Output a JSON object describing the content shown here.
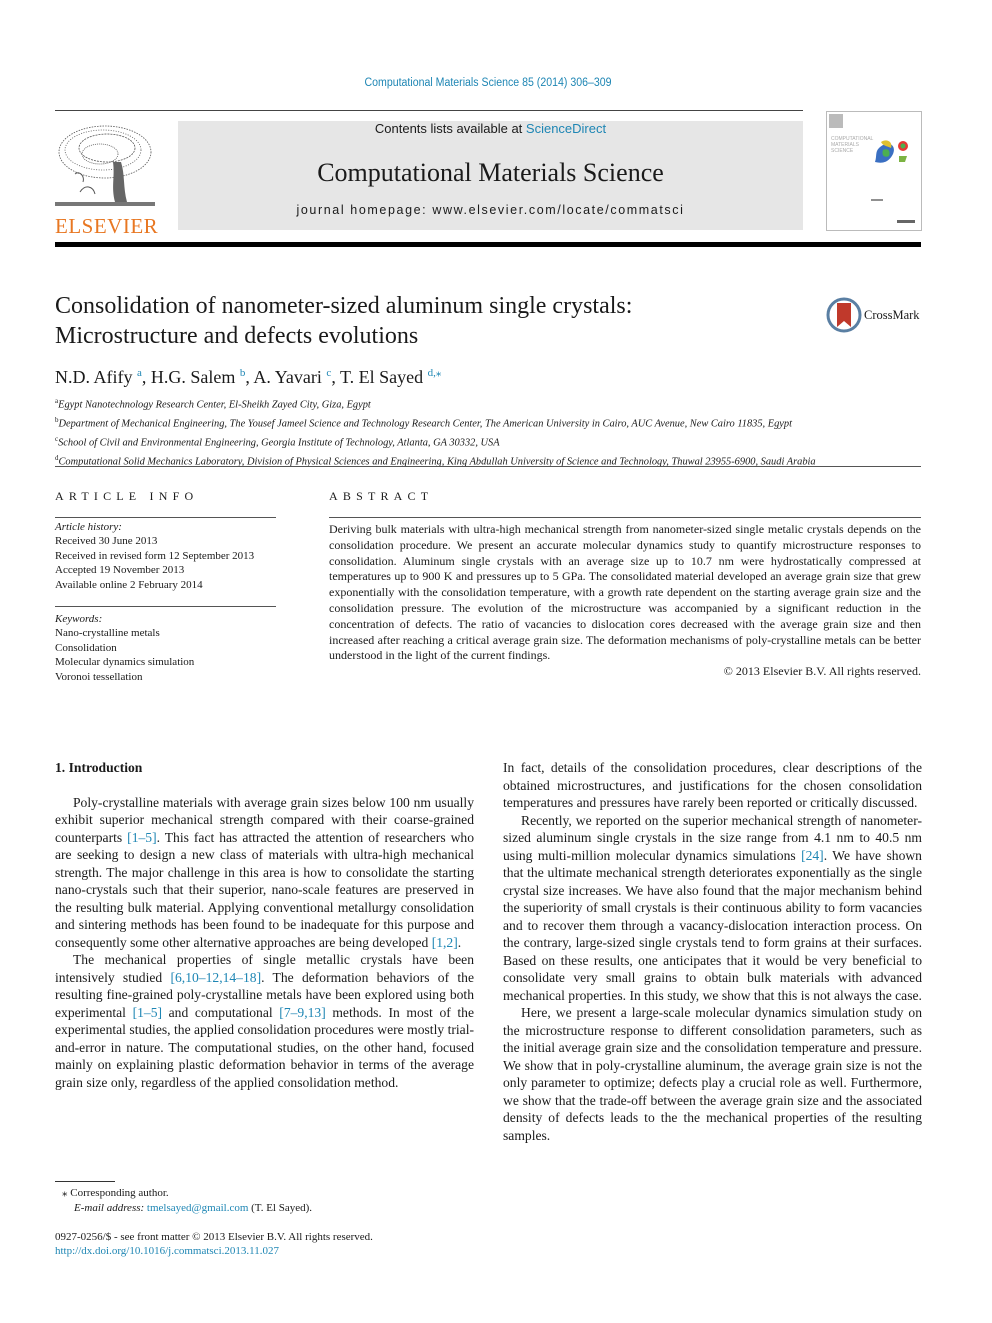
{
  "header": {
    "journal_ref": "Computational Materials Science 85 (2014) 306–309",
    "contents_prefix": "Contents lists available at ",
    "contents_link": "ScienceDirect",
    "journal_name": "Computational Materials Science",
    "homepage_prefix": "journal homepage: ",
    "homepage_url": "www.elsevier.com/locate/commatsci",
    "publisher_logo": "ELSEVIER",
    "cover_title": "COMPUTATIONAL MATERIALS SCIENCE"
  },
  "article": {
    "title_line1": "Consolidation of nanometer-sized aluminum single crystals:",
    "title_line2": "Microstructure and defects evolutions",
    "crossmark": "CrossMark",
    "authors": [
      {
        "name": "N.D. Afify",
        "sup": "a"
      },
      {
        "name": "H.G. Salem",
        "sup": "b"
      },
      {
        "name": "A. Yavari",
        "sup": "c"
      },
      {
        "name": "T. El Sayed",
        "sup": "d,⁎"
      }
    ],
    "affiliations": [
      {
        "sup": "a",
        "text": "Egypt Nanotechnology Research Center, El-Sheikh Zayed City, Giza, Egypt"
      },
      {
        "sup": "b",
        "text": "Department of Mechanical Engineering, The Yousef Jameel Science and Technology Research Center, The American University in Cairo, AUC Avenue, New Cairo 11835, Egypt"
      },
      {
        "sup": "c",
        "text": "School of Civil and Environmental Engineering, Georgia Institute of Technology, Atlanta, GA 30332, USA"
      },
      {
        "sup": "d",
        "text": "Computational Solid Mechanics Laboratory, Division of Physical Sciences and Engineering, King Abdullah University of Science and Technology, Thuwal 23955-6900, Saudi Arabia"
      }
    ]
  },
  "article_info": {
    "heading": "ARTICLE INFO",
    "history_label": "Article history:",
    "history": [
      "Received 30 June 2013",
      "Received in revised form 12 September 2013",
      "Accepted 19 November 2013",
      "Available online 2 February 2014"
    ],
    "keywords_label": "Keywords:",
    "keywords": [
      "Nano-crystalline metals",
      "Consolidation",
      "Molecular dynamics simulation",
      "Voronoi tessellation"
    ]
  },
  "abstract": {
    "heading": "ABSTRACT",
    "text": "Deriving bulk materials with ultra-high mechanical strength from nanometer-sized single metalic crystals depends on the consolidation procedure. We present an accurate molecular dynamics study to quantify microstructure responses to consolidation. Aluminum single crystals with an average size up to 10.7 nm were hydrostatically compressed at temperatures up to 900 K and pressures up to 5 GPa. The consolidated material developed an average grain size that grew exponentially with the consolidation temperature, with a growth rate dependent on the starting average grain size and the consolidation pressure. The evolution of the microstructure was accompanied by a significant reduction in the concentration of defects. The ratio of vacancies to dislocation cores decreased with the average grain size and then increased after reaching a critical average grain size. The deformation mechanisms of poly-crystalline metals can be better understood in the light of the current findings.",
    "copyright": "© 2013 Elsevier B.V. All rights reserved."
  },
  "body": {
    "section_heading": "1. Introduction",
    "col1": {
      "p1_a": "Poly-crystalline materials with average grain sizes below 100 nm usually exhibit superior mechanical strength compared with their coarse-grained counterparts ",
      "p1_ref1": "[1–5]",
      "p1_b": ". This fact has attracted the attention of researchers who are seeking to design a new class of materials with ultra-high mechanical strength. The major challenge in this area is how to consolidate the starting nano-crystals such that their superior, nano-scale features are preserved in the resulting bulk material. Applying conventional metallurgy consolidation and sintering methods has been found to be inadequate for this purpose and consequently some other alternative approaches are being developed ",
      "p1_ref2": "[1,2]",
      "p1_c": ".",
      "p2_a": "The mechanical properties of single metallic crystals have been intensively studied ",
      "p2_ref1": "[6,10–12,14–18]",
      "p2_b": ". The deformation behaviors of the resulting fine-grained poly-crystalline metals have been explored using both experimental ",
      "p2_ref2": "[1–5]",
      "p2_c": " and computational ",
      "p2_ref3": "[7–9,13]",
      "p2_d": " methods. In most of the experimental studies, the applied consolidation procedures were mostly trial-and-error in nature. The computational studies, on the other hand, focused mainly on explaining plastic deformation behavior in terms of the average grain size only, regardless of the applied consolidation method."
    },
    "col2": {
      "p1": "In fact, details of the consolidation procedures, clear descriptions of the obtained microstructures, and justifications for the chosen consolidation temperatures and pressures have rarely been reported or critically discussed.",
      "p2_a": "Recently, we reported on the superior mechanical strength of nanometer-sized aluminum single crystals in the size range from 4.1 nm to 40.5 nm using multi-million molecular dynamics simulations ",
      "p2_ref": "[24]",
      "p2_b": ". We have shown that the ultimate mechanical strength deteriorates exponentially as the single crystal size increases. We have also found that the major mechanism behind the superiority of small crystals is their continuous ability to form vacancies and to recover them through a vacancy-dislocation interaction process. On the contrary, large-sized single crystals tend to form grains at their surfaces. Based on these results, one anticipates that it would be very beneficial to consolidate very small grains to obtain bulk materials with advanced mechanical properties. In this study, we show that this is not always the case.",
      "p3": "Here, we present a large-scale molecular dynamics simulation study on the microstructure response to different consolidation parameters, such as the initial average grain size and the consolidation temperature and pressure. We show that in poly-crystalline aluminum, the average grain size is not the only parameter to optimize; defects play a crucial role as well. Furthermore, we show that the trade-off between the average grain size and the associated density of defects leads to the the mechanical properties of the resulting samples."
    }
  },
  "footnote": {
    "star": "⁎",
    "corresponding": "Corresponding author.",
    "email_label": "E-mail address:",
    "email": "tmelsayed@gmail.com",
    "email_owner": " (T. El Sayed)."
  },
  "footer": {
    "issn_line": "0927-0256/$ - see front matter © 2013 Elsevier B.V. All rights reserved.",
    "doi": "http://dx.doi.org/10.1016/j.commatsci.2013.11.027"
  },
  "colors": {
    "link": "#1e86b4",
    "elsevier_orange": "#e87722",
    "banner_bg": "#e6e6e6"
  }
}
